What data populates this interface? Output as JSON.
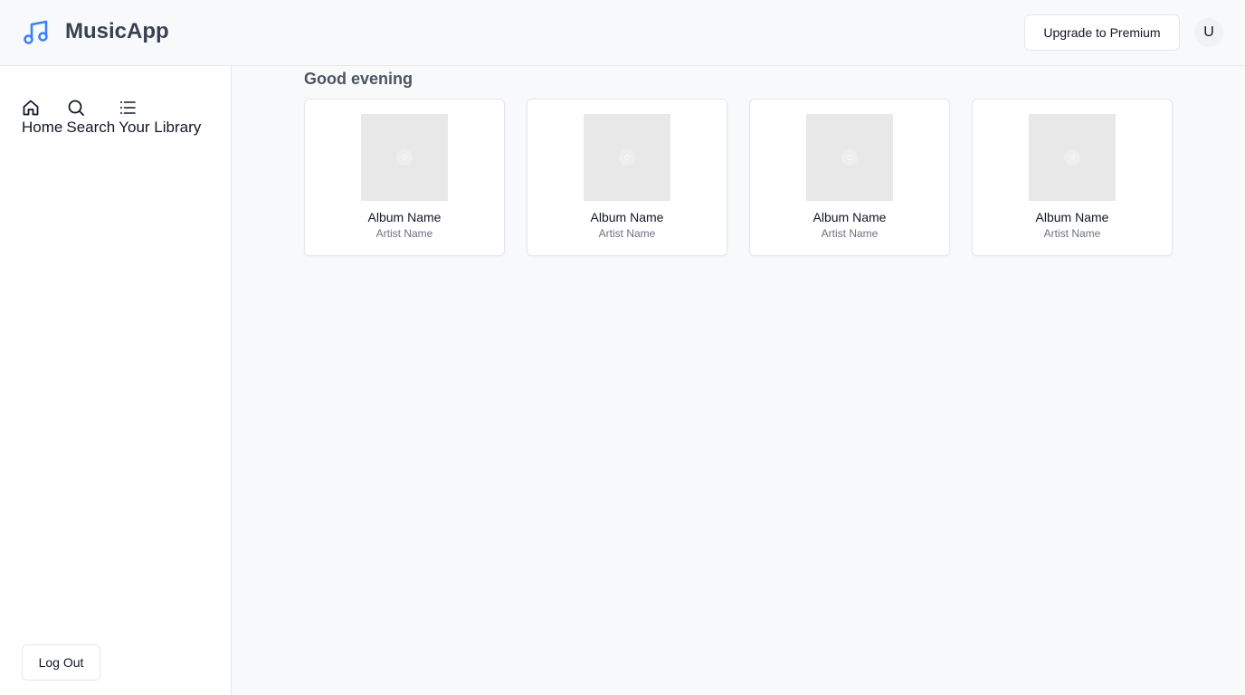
{
  "header": {
    "app_title": "MusicApp",
    "logo_icon": "music-note-icon",
    "premium_label": "Upgrade to Premium",
    "avatar_initial": "U",
    "accent_color": "#3b82f6"
  },
  "sidebar": {
    "items": [
      {
        "label": "Home",
        "icon": "home-icon"
      },
      {
        "label": "Search",
        "icon": "search-icon"
      },
      {
        "label": "Your Library",
        "icon": "list-icon"
      }
    ],
    "logout_label": "Log Out"
  },
  "main": {
    "greeting": "Good evening",
    "albums": [
      {
        "title": "Album Name",
        "artist": "Artist Name",
        "icon": "disc-icon"
      },
      {
        "title": "Album Name",
        "artist": "Artist Name",
        "icon": "disc-icon"
      },
      {
        "title": "Album Name",
        "artist": "Artist Name",
        "icon": "disc-icon"
      },
      {
        "title": "Album Name",
        "artist": "Artist Name",
        "icon": "disc-icon"
      }
    ]
  }
}
